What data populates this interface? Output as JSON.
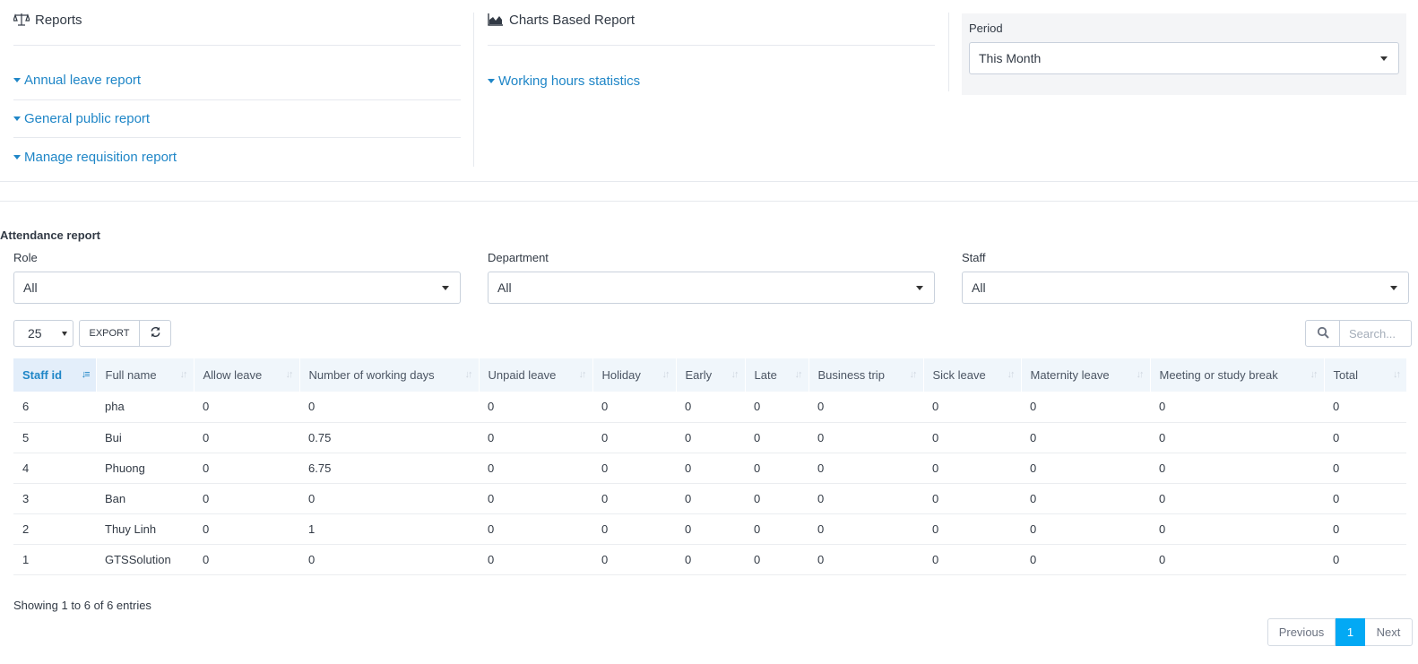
{
  "reports": {
    "title": "Reports",
    "links": [
      "Annual leave report",
      "General public report",
      "Manage requisition report"
    ]
  },
  "charts": {
    "title": "Charts Based Report",
    "links": [
      "Working hours statistics"
    ]
  },
  "period": {
    "label": "Period",
    "value": "This Month"
  },
  "attendance": {
    "title": "Attendance report",
    "filters": {
      "role": {
        "label": "Role",
        "value": "All"
      },
      "department": {
        "label": "Department",
        "value": "All"
      },
      "staff": {
        "label": "Staff",
        "value": "All"
      }
    },
    "page_length": "25",
    "export_label": "EXPORT",
    "search_placeholder": "Search...",
    "columns": [
      "Staff id",
      "Full name",
      "Allow leave",
      "Number of working days",
      "Unpaid leave",
      "Holiday",
      "Early",
      "Late",
      "Business trip",
      "Sick leave",
      "Maternity leave",
      "Meeting or study break",
      "Total"
    ],
    "rows": [
      [
        "6",
        "pha",
        "0",
        "0",
        "0",
        "0",
        "0",
        "0",
        "0",
        "0",
        "0",
        "0",
        "0"
      ],
      [
        "5",
        "Bui",
        "0",
        "0.75",
        "0",
        "0",
        "0",
        "0",
        "0",
        "0",
        "0",
        "0",
        "0"
      ],
      [
        "4",
        "Phuong",
        "0",
        "6.75",
        "0",
        "0",
        "0",
        "0",
        "0",
        "0",
        "0",
        "0",
        "0"
      ],
      [
        "3",
        "Ban",
        "0",
        "0",
        "0",
        "0",
        "0",
        "0",
        "0",
        "0",
        "0",
        "0",
        "0"
      ],
      [
        "2",
        "Thuy Linh",
        "0",
        "1",
        "0",
        "0",
        "0",
        "0",
        "0",
        "0",
        "0",
        "0",
        "0"
      ],
      [
        "1",
        "GTSSolution",
        "0",
        "0",
        "0",
        "0",
        "0",
        "0",
        "0",
        "0",
        "0",
        "0",
        "0"
      ]
    ],
    "info": "Showing 1 to 6 of 6 entries",
    "pagination": {
      "previous": "Previous",
      "current": "1",
      "next": "Next"
    }
  },
  "colors": {
    "link": "#1f86c7",
    "accent": "#03a9f4",
    "header_bg": "#f0f6fb"
  },
  "icons": {
    "reports": "balance-scale-icon",
    "charts": "area-chart-icon",
    "search": "search-icon",
    "refresh": "refresh-icon"
  }
}
